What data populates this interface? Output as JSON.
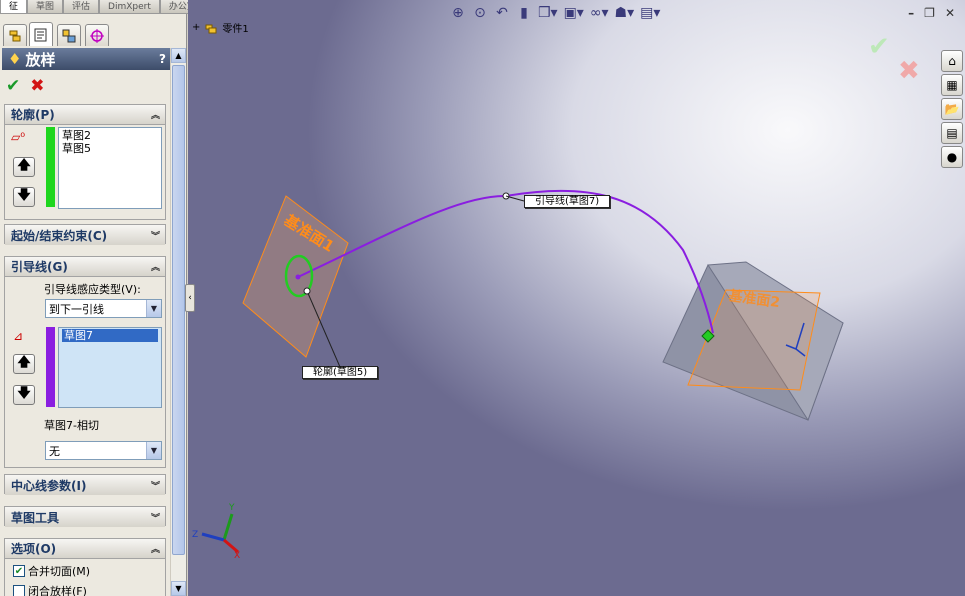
{
  "top_tabs": [
    "征",
    "草图",
    "评估",
    "DimXpert",
    "办公室产品"
  ],
  "feature": {
    "title": "放样",
    "help": "?",
    "ok_symbol": "✔",
    "cancel_symbol": "✖"
  },
  "profiles": {
    "heading": "轮廓(P)",
    "items": [
      "草图2",
      "草图5"
    ]
  },
  "start_end": {
    "heading": "起始/结束约束(C)"
  },
  "guides": {
    "heading": "引导线(G)",
    "influence_label": "引导线感应类型(V):",
    "influence_value": "到下一引线",
    "items": [
      "草图7"
    ],
    "tangency_label": "草图7-相切",
    "tangency_value": "无"
  },
  "centerline": {
    "heading": "中心线参数(I)"
  },
  "sketch_tools": {
    "heading": "草图工具"
  },
  "options": {
    "heading": "选项(O)",
    "merge_tangent_faces": "合并切面(M)",
    "merge_checked": true,
    "close_loft": "闭合放样(F)",
    "close_checked": false
  },
  "viewport": {
    "tree_root": "零件1",
    "plane1_label": "基准面1",
    "plane2_label": "基准面2",
    "guide_callout": "引导线(草图7)",
    "profile_callout": "轮廓(草图5)",
    "triad": {
      "x": "X",
      "y": "Y",
      "z": "Z"
    },
    "colors": {
      "guide_curve": "#8a1ee0",
      "profile_circle": "#22cc22",
      "plane_edge": "#ff8c1a",
      "box_face": "#8f93a6"
    }
  },
  "icons": {
    "view_toolbar": [
      "zoom-to-fit-icon",
      "zoom-area-icon",
      "previous-view-icon",
      "section-view-icon",
      "view-orientation-icon",
      "display-style-icon",
      "hide-show-icon",
      "edit-appearance-icon",
      "apply-scene-icon"
    ],
    "taskpane": [
      "home-icon",
      "design-library-icon",
      "file-explorer-icon",
      "view-palette-icon",
      "appearances-icon"
    ]
  }
}
